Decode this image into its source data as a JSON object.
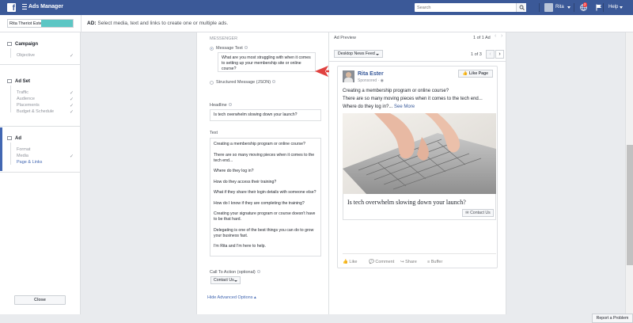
{
  "topbar": {
    "logo": "f",
    "app_title": "Ads Manager",
    "search_placeholder": "Search",
    "user_name": "Rita",
    "notification_count": "2",
    "help": "Help"
  },
  "subheader": {
    "account_name": "Rita Theriot Ester",
    "section_prefix": "AD:",
    "section_text": "Select media, text and links to create one or multiple ads."
  },
  "nav": {
    "campaign": {
      "label": "Campaign",
      "items": [
        "Objective"
      ]
    },
    "adset": {
      "label": "Ad Set",
      "items": [
        "Traffic",
        "Audience",
        "Placements",
        "Budget & Schedule"
      ]
    },
    "ad": {
      "label": "Ad",
      "items": [
        "Format",
        "Media",
        "Page & Links"
      ]
    },
    "close_label": "Close",
    "check": "✓"
  },
  "form": {
    "messenger_label": "MESSENGER",
    "message_text_label": "Message Text",
    "message_text_value": "What are you most struggling with when it comes to setting up your membership site or online course?",
    "structured_label": "Structured Message (JSON)",
    "headline_label": "Headline",
    "headline_value": "Is tech overwhelm slowing down your launch?",
    "text_label": "Text",
    "text_paragraphs": [
      "Creating a membership program or online course?",
      "There are so many moving pieces when it comes to the tech end...",
      "Where do they log in?",
      "How do they access their training?",
      "What if they share their login details with someone else?",
      "How do I know if they are completing the training?",
      "Creating your signature program or course doesn't have to be that hard.",
      "Delegating is one of the best things you can do to grow your business fast.",
      "I'm Rita and I'm here to help."
    ],
    "cta_label": "Call To Action (optional)",
    "cta_value": "Contact Us",
    "hide_advanced": "Hide Advanced Options ▴"
  },
  "preview": {
    "title": "Ad Preview",
    "ad_count": "1 of 1 Ad",
    "placement": "Desktop News Feed",
    "placement_count": "1 of 3",
    "page_name": "Rita Ester",
    "sponsored": "Sponsored ·",
    "like_page": "Like Page",
    "post_line1": "Creating a membership program or online course?",
    "post_line2": "There are so many moving pieces when it comes to the tech end...",
    "post_line3": "Where do they log in?...",
    "see_more": "See More",
    "headline": "Is tech overwhelm slowing down your launch?",
    "contact_us": "Contact Us",
    "actions": [
      "Like",
      "Comment",
      "Share",
      "Buffer"
    ]
  },
  "footer": {
    "report": "Report a Problem"
  },
  "colors": {
    "brand": "#3b5998",
    "accent": "#4267b2",
    "arrow": "#e0413f",
    "teal": "#5cc6c4"
  }
}
